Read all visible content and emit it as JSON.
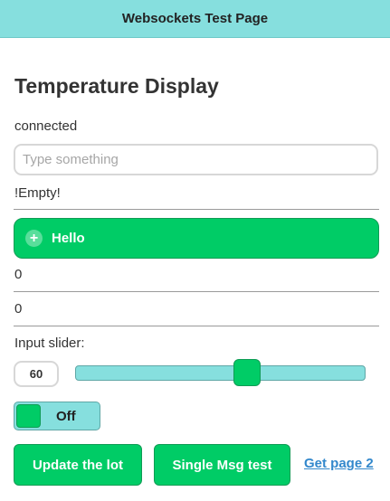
{
  "header": {
    "title": "Websockets Test Page"
  },
  "main": {
    "title": "Temperature Display",
    "status": "connected",
    "input": {
      "placeholder": "Type something",
      "value": ""
    },
    "echo_text": "!Empty!",
    "hello_button": {
      "label": "Hello",
      "icon": "plus-icon"
    },
    "value_1": "0",
    "value_2": "0",
    "slider": {
      "label": "Input slider:",
      "value": "60",
      "level": 0.6
    },
    "toggle": {
      "label": "Off"
    },
    "buttons": {
      "update_label": "Update the lot",
      "single_label": "Single Msg test"
    },
    "link": {
      "label": "Get page 2"
    }
  },
  "colors": {
    "header_bg": "#86dfde",
    "accent_green": "#00cc66",
    "link_blue": "#3388cc"
  }
}
